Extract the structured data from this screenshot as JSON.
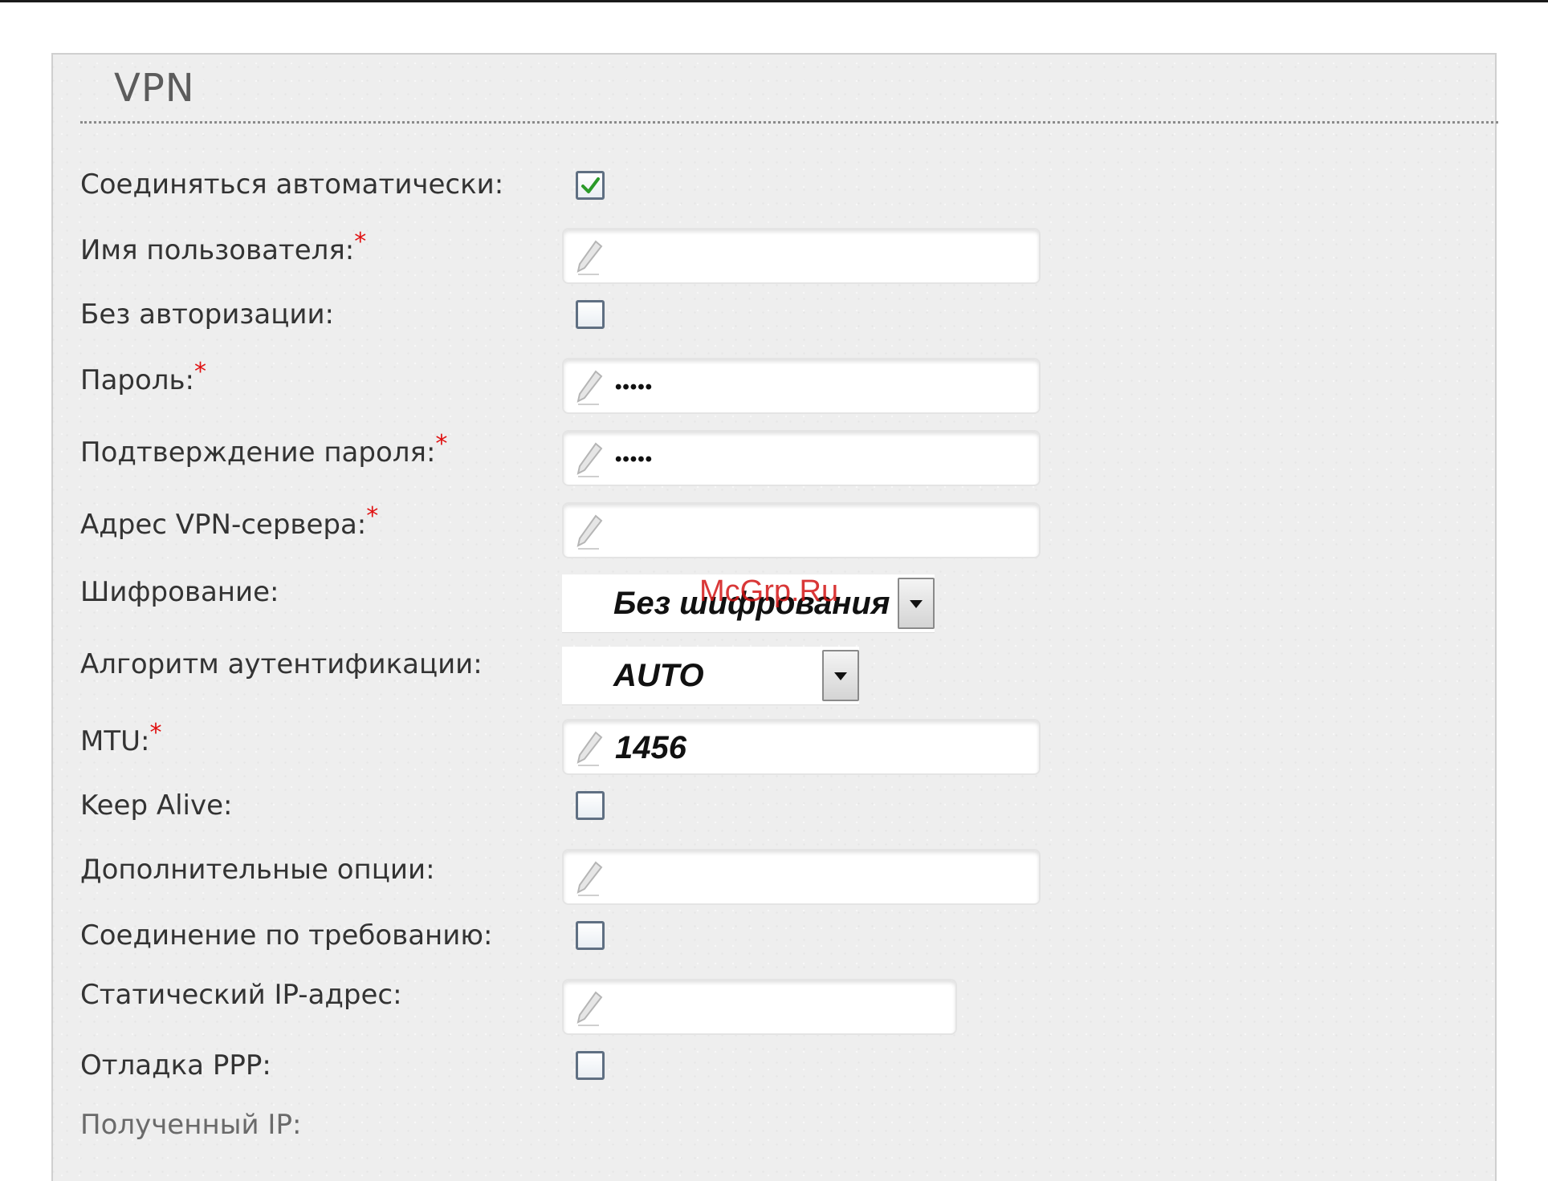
{
  "panel": {
    "title": "VPN"
  },
  "form": {
    "auto_connect": {
      "label": "Соединяться автоматически:",
      "checked": true
    },
    "username": {
      "label": "Имя пользователя:",
      "required": "*",
      "value": ""
    },
    "no_auth": {
      "label": "Без авторизации:",
      "checked": false
    },
    "password": {
      "label": "Пароль:",
      "required": "*",
      "value": "•••••"
    },
    "password_confirm": {
      "label": "Подтверждение пароля:",
      "required": "*",
      "value": "•••••"
    },
    "vpn_server": {
      "label": "Адрес VPN-сервера:",
      "required": "*",
      "value": ""
    },
    "encryption": {
      "label": "Шифрование:",
      "value": "Без шифрования"
    },
    "auth_algorithm": {
      "label": "Алгоритм аутентификации:",
      "value": "AUTO"
    },
    "mtu": {
      "label": "MTU:",
      "required": "*",
      "value": "1456"
    },
    "keep_alive": {
      "label": "Keep Alive:",
      "checked": false
    },
    "extra_options": {
      "label": "Дополнительные опции:",
      "value": ""
    },
    "on_demand": {
      "label": "Соединение по требованию:",
      "checked": false
    },
    "static_ip": {
      "label": "Статический IP-адрес:",
      "value": ""
    },
    "ppp_debug": {
      "label": "Отладка PPP:",
      "checked": false
    },
    "received_ip": {
      "label": "Полученный IP:"
    }
  },
  "watermark": "McGrp.Ru",
  "icons": {
    "field": "pencil-icon",
    "checked": "checkmark-icon",
    "dropdown": "dropdown-arrow-icon"
  },
  "colors": {
    "required": "#e01010",
    "checkmark": "#2a9a2a",
    "panel_bg": "#eeeeee"
  }
}
